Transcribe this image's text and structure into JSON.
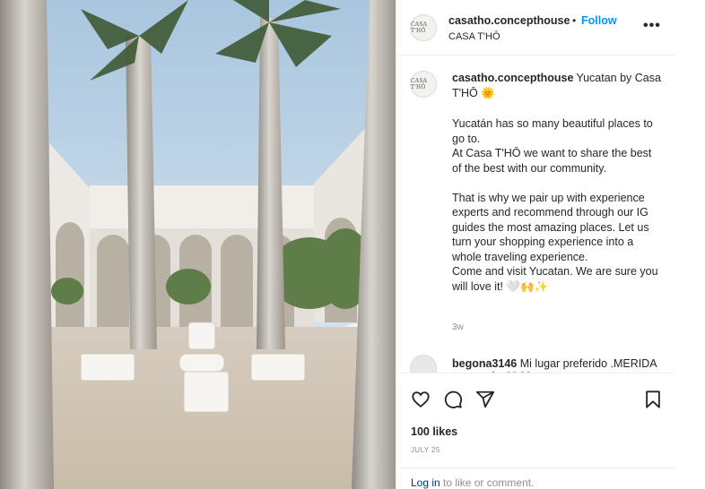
{
  "post": {
    "username": "casatho.concepthouse",
    "avatar_text": "CASA T'HŌ",
    "follow_label": "Follow",
    "location": "CASA T'HŌ",
    "more_icon": "more-options-icon"
  },
  "caption": {
    "lead": "Yucatan by Casa T'HŌ 🌞",
    "lines": [
      "Yucatán has so many beautiful places to go to.",
      "At Casa T'HŌ we want to share the best of the best with our community.",
      "That is why we pair up with experience experts and recommend through our IG guides the most amazing places. Let us turn your shopping experience into a whole traveling experience.",
      "Come and visit Yucatan. We are sure you will love it! 🤍🙌✨"
    ],
    "time_ago": "3w"
  },
  "comment": {
    "username": "begona3146",
    "text": "Mi lugar preferido .MERIDA YUCATÁN❤️❤️"
  },
  "actions": {
    "icons": [
      "heart-icon",
      "comment-icon",
      "share-icon",
      "bookmark-icon"
    ],
    "likes": "100 likes",
    "date": "JULY 25",
    "login_link": "Log in",
    "login_rest": " to like or comment."
  },
  "colors": {
    "accent": "#0095f6",
    "text": "#262626",
    "muted": "#8e8e8e",
    "link": "#00376b"
  }
}
